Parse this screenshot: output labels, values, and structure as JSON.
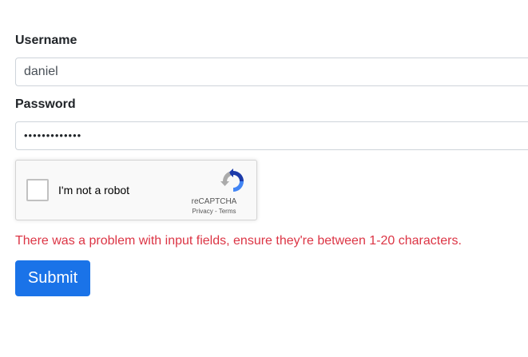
{
  "form": {
    "username_label": "Username",
    "username_value": "daniel",
    "password_label": "Password",
    "password_mask": "•••••••••••••",
    "error_message": "There was a problem with input fields, ensure they're between 1-20 characters.",
    "submit_label": "Submit"
  },
  "recaptcha": {
    "checkbox_label": "I'm not a robot",
    "brand": "reCAPTCHA",
    "links": "Privacy - Terms"
  },
  "colors": {
    "error": "#dc3545",
    "submit_bg": "#1a73e8"
  }
}
